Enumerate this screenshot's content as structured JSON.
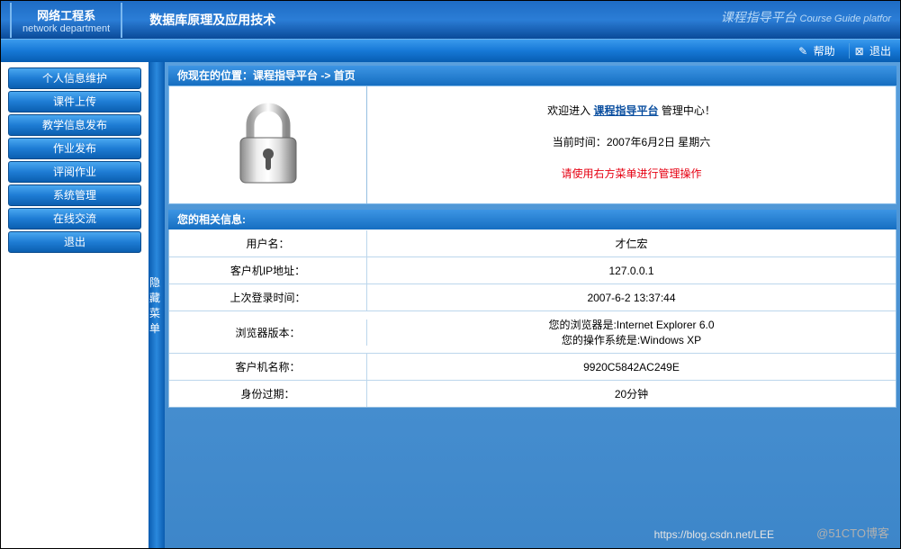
{
  "header": {
    "dept_cn": "网络工程系",
    "dept_en": "network department",
    "course_title": "数据库原理及应用技术",
    "platform_cn": "课程指导平台",
    "platform_en": "Course Guide platfor"
  },
  "subheader": {
    "help": "帮助",
    "logout": "退出"
  },
  "sidebar": {
    "items": [
      "个人信息维护",
      "课件上传",
      "教学信息发布",
      "作业发布",
      "评阅作业",
      "系统管理",
      "在线交流",
      "退出"
    ]
  },
  "vbar_label": "隐藏菜单",
  "breadcrumb": "你现在的位置：课程指导平台 -> 首页",
  "welcome": {
    "prefix": "欢迎进入",
    "platform": "课程指导平台",
    "suffix": "管理中心！",
    "time_label": "当前时间：",
    "time_value": "2007年6月2日 星期六",
    "hint": "请使用右方菜单进行管理操作"
  },
  "info_title": "您的相关信息:",
  "info_rows": [
    {
      "label": "用户名：",
      "value": "才仁宏"
    },
    {
      "label": "客户机IP地址：",
      "value": "127.0.0.1"
    },
    {
      "label": "上次登录时间：",
      "value": "2007-6-2 13:37:44"
    },
    {
      "label": "浏览器版本：",
      "value": "您的浏览器是:Internet Explorer 6.0\n您的操作系统是:Windows XP"
    },
    {
      "label": "客户机名称：",
      "value": "9920C5842AC249E"
    },
    {
      "label": "身份过期：",
      "value": "20分钟"
    }
  ],
  "watermark": "@51CTO博客",
  "watermark2": "https://blog.csdn.net/LEE"
}
